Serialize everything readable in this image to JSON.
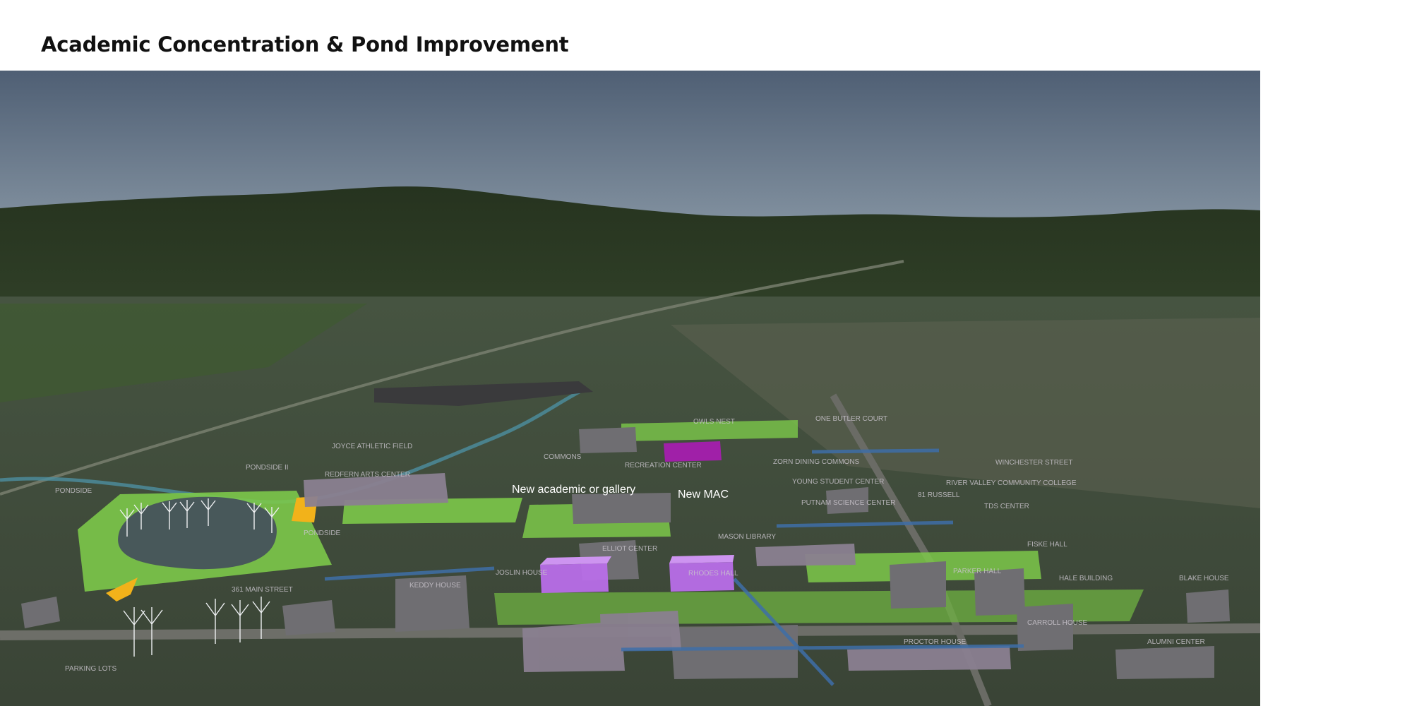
{
  "page": {
    "title": "Academic Concentration & Pond Improvement"
  },
  "callouts": {
    "new_academic": "New academic or gallery",
    "new_mac": "New MAC"
  },
  "building_labels": [
    "JOYCE ATHLETIC FIELD",
    "PONDSIDE II",
    "REDFERN ARTS CENTER",
    "PONDSIDE",
    "PONDSIDE",
    "361 MAIN STREET",
    "KEDDY HOUSE",
    "JOSLIN HOUSE",
    "ELLIOT CENTER",
    "RHODES HALL",
    "MASON LIBRARY",
    "RECREATION CENTER",
    "OWLS NEST",
    "ONE BUTLER COURT",
    "ZORN DINING COMMONS",
    "YOUNG STUDENT CENTER",
    "PUTNAM SCIENCE CENTER",
    "81 RUSSELL",
    "RIVER VALLEY COMMUNITY COLLEGE",
    "TDS CENTER",
    "FISKE HALL",
    "PARKER HALL",
    "HALE BUILDING",
    "BLAKE HOUSE",
    "CARROLL HOUSE",
    "PROCTOR HOUSE",
    "ALUMNI CENTER",
    "PARKING LOTS",
    "WINCHESTER STREET",
    "COMMONS"
  ],
  "colors": {
    "green_space": "#7cc84a",
    "proposed_academic": "#b86ee8",
    "proposed_mac": "#b86ee8",
    "existing_building": "#8a7f90",
    "pond": "#48585a",
    "pathway": "#3e6ea8",
    "highlight_yellow": "#f2b21a"
  }
}
